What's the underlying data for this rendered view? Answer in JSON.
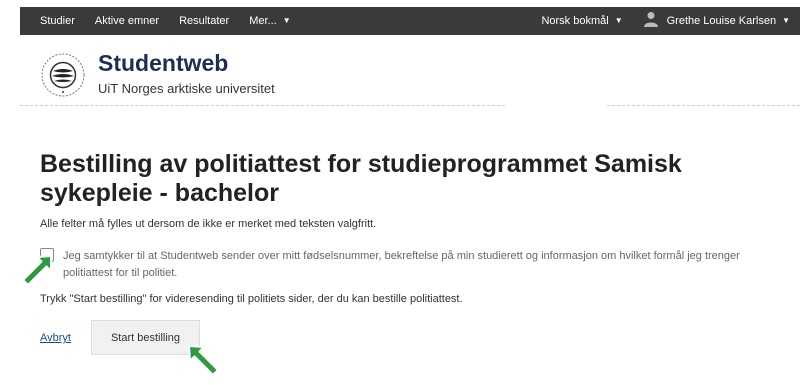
{
  "topbar": {
    "nav": [
      {
        "label": "Studier"
      },
      {
        "label": "Aktive emner"
      },
      {
        "label": "Resultater"
      },
      {
        "label": "Mer..."
      }
    ],
    "language": "Norsk bokmål",
    "user": "Grethe Louise Karlsen"
  },
  "brand": {
    "title": "Studentweb",
    "subtitle": "UiT Norges arktiske universitet"
  },
  "main": {
    "heading": "Bestilling av politiattest for studieprogrammet Samisk sykepleie - bachelor",
    "intro": "Alle felter må fylles ut dersom de ikke er merket med teksten valgfritt.",
    "consent_text": "Jeg samtykker til at Studentweb sender over mitt fødselsnummer, bekreftelse på min studierett og informasjon om hvilket formål jeg trenger politiattest for til politiet.",
    "consent_checked": false,
    "instruction": "Trykk \"Start bestilling\" for videresending til politiets sider, der du kan bestille politiattest.",
    "cancel_label": "Avbryt",
    "start_label": "Start bestilling"
  },
  "colors": {
    "topbar": "#3a3a3a",
    "brand_title": "#1b2f52",
    "link": "#1a4e8a",
    "arrow": "#2f9a41"
  }
}
